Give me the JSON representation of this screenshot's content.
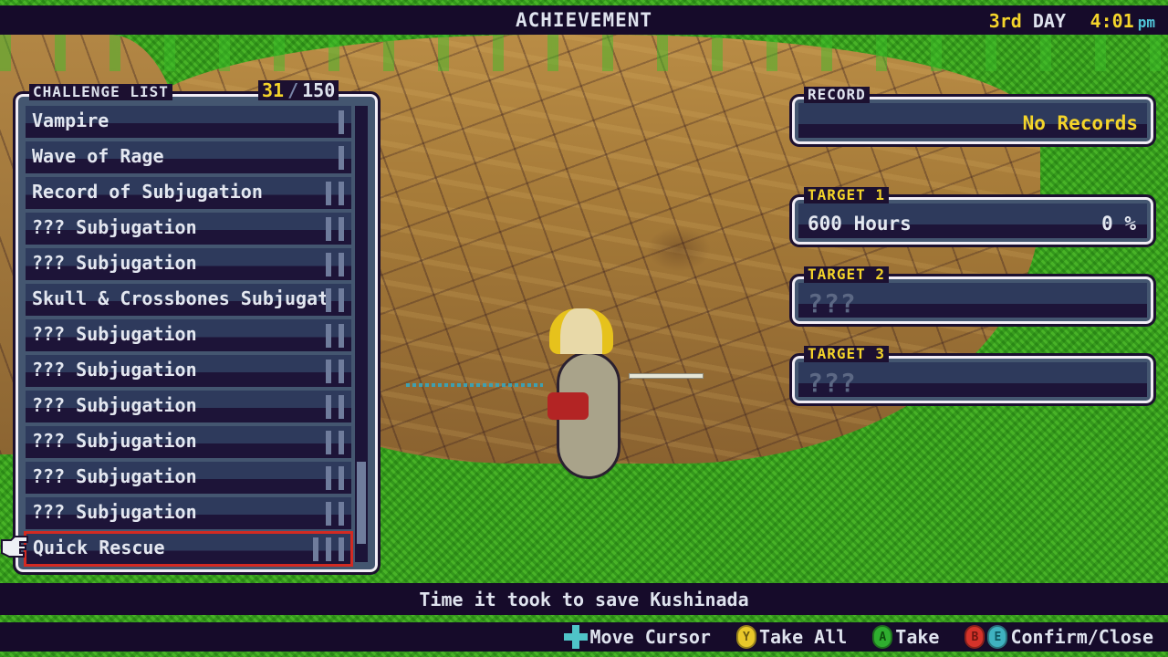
{
  "header": {
    "title": "ACHIEVEMENT",
    "day_number": "3rd",
    "day_label": "DAY",
    "time": "4:01",
    "ampm": "pm"
  },
  "challenge_list": {
    "label": "CHALLENGE LIST",
    "count_current": "31",
    "count_separator": "/",
    "count_total": "150",
    "scroll_position": 0.95,
    "items": [
      {
        "name": "Vampire",
        "rank": 1
      },
      {
        "name": "Wave of Rage",
        "rank": 1
      },
      {
        "name": "Record of Subjugation",
        "rank": 2
      },
      {
        "name": "??? Subjugation",
        "rank": 2
      },
      {
        "name": "??? Subjugation",
        "rank": 2
      },
      {
        "name": "Skull & Crossbones Subjugation",
        "rank": 2
      },
      {
        "name": "??? Subjugation",
        "rank": 2
      },
      {
        "name": "??? Subjugation",
        "rank": 2
      },
      {
        "name": "??? Subjugation",
        "rank": 2
      },
      {
        "name": "??? Subjugation",
        "rank": 2
      },
      {
        "name": "??? Subjugation",
        "rank": 2
      },
      {
        "name": "??? Subjugation",
        "rank": 2
      },
      {
        "name": "Quick Rescue",
        "rank": 3,
        "selected": true
      }
    ]
  },
  "record": {
    "label": "RECORD",
    "value": "No Records"
  },
  "targets": [
    {
      "label": "TARGET 1",
      "name": "600 Hours",
      "progress": "0 %"
    },
    {
      "label": "TARGET 2",
      "name": "???",
      "progress": ""
    },
    {
      "label": "TARGET 3",
      "name": "???",
      "progress": ""
    }
  ],
  "description": "Time it took to save Kushinada",
  "help": {
    "move_cursor": "Move Cursor",
    "take_all": "Take All",
    "take": "Take",
    "confirm_close": "Confirm/Close",
    "glyphs": {
      "y": "Y",
      "a": "A",
      "b": "B",
      "e": "E"
    }
  },
  "colors": {
    "accent_yellow": "#f4d42a",
    "accent_cyan": "#4fc4d8",
    "selection_red": "#d22a22",
    "bar_dark": "#160b2a"
  }
}
